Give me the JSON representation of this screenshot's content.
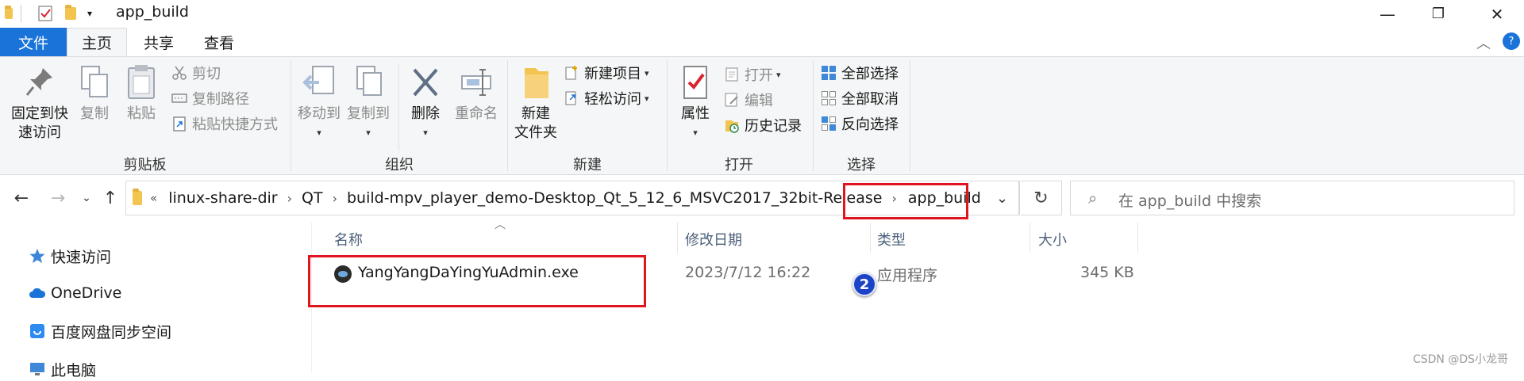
{
  "window": {
    "title": "app_build",
    "controls": {
      "minimize": "—",
      "maximize": "❐",
      "close": "✕"
    }
  },
  "ribbon_tabs": {
    "file": "文件",
    "home": "主页",
    "share": "共享",
    "view": "查看"
  },
  "ribbon": {
    "clipboard": {
      "label": "剪贴板",
      "pin": "固定到快\n速访问",
      "copy": "复制",
      "paste": "粘贴",
      "cut": "剪切",
      "copy_path": "复制路径",
      "paste_shortcut": "粘贴快捷方式"
    },
    "organize": {
      "label": "组织",
      "move_to": "移动到",
      "copy_to": "复制到",
      "delete": "删除",
      "rename": "重命名"
    },
    "new": {
      "label": "新建",
      "new_folder": "新建\n文件夹",
      "new_item": "新建项目",
      "easy_access": "轻松访问"
    },
    "open": {
      "label": "打开",
      "properties": "属性",
      "open": "打开",
      "edit": "编辑",
      "history": "历史记录"
    },
    "select": {
      "label": "选择",
      "select_all": "全部选择",
      "select_none": "全部取消",
      "invert": "反向选择"
    }
  },
  "address": {
    "overflow": "«",
    "crumbs": [
      "linux-share-dir",
      "QT",
      "build-mpv_player_demo-Desktop_Qt_5_12_6_MSVC2017_32bit-Release",
      "app_build"
    ]
  },
  "search": {
    "placeholder": "在 app_build 中搜索"
  },
  "nav_pane": {
    "quick_access": "快速访问",
    "onedrive": "OneDrive",
    "baidu": "百度网盘同步空间",
    "this_pc": "此电脑"
  },
  "columns": {
    "name": "名称",
    "date": "修改日期",
    "type": "类型",
    "size": "大小"
  },
  "files": [
    {
      "name": "YangYangDaYingYuAdmin.exe",
      "date": "2023/7/12 16:22",
      "type": "应用程序",
      "size": "345 KB"
    }
  ],
  "annotation_badge": "2",
  "watermark": "CSDN @DS小龙哥",
  "colors": {
    "accent": "#1a73d9",
    "highlight_box": "#e0141e",
    "badge": "#1c43c6"
  }
}
